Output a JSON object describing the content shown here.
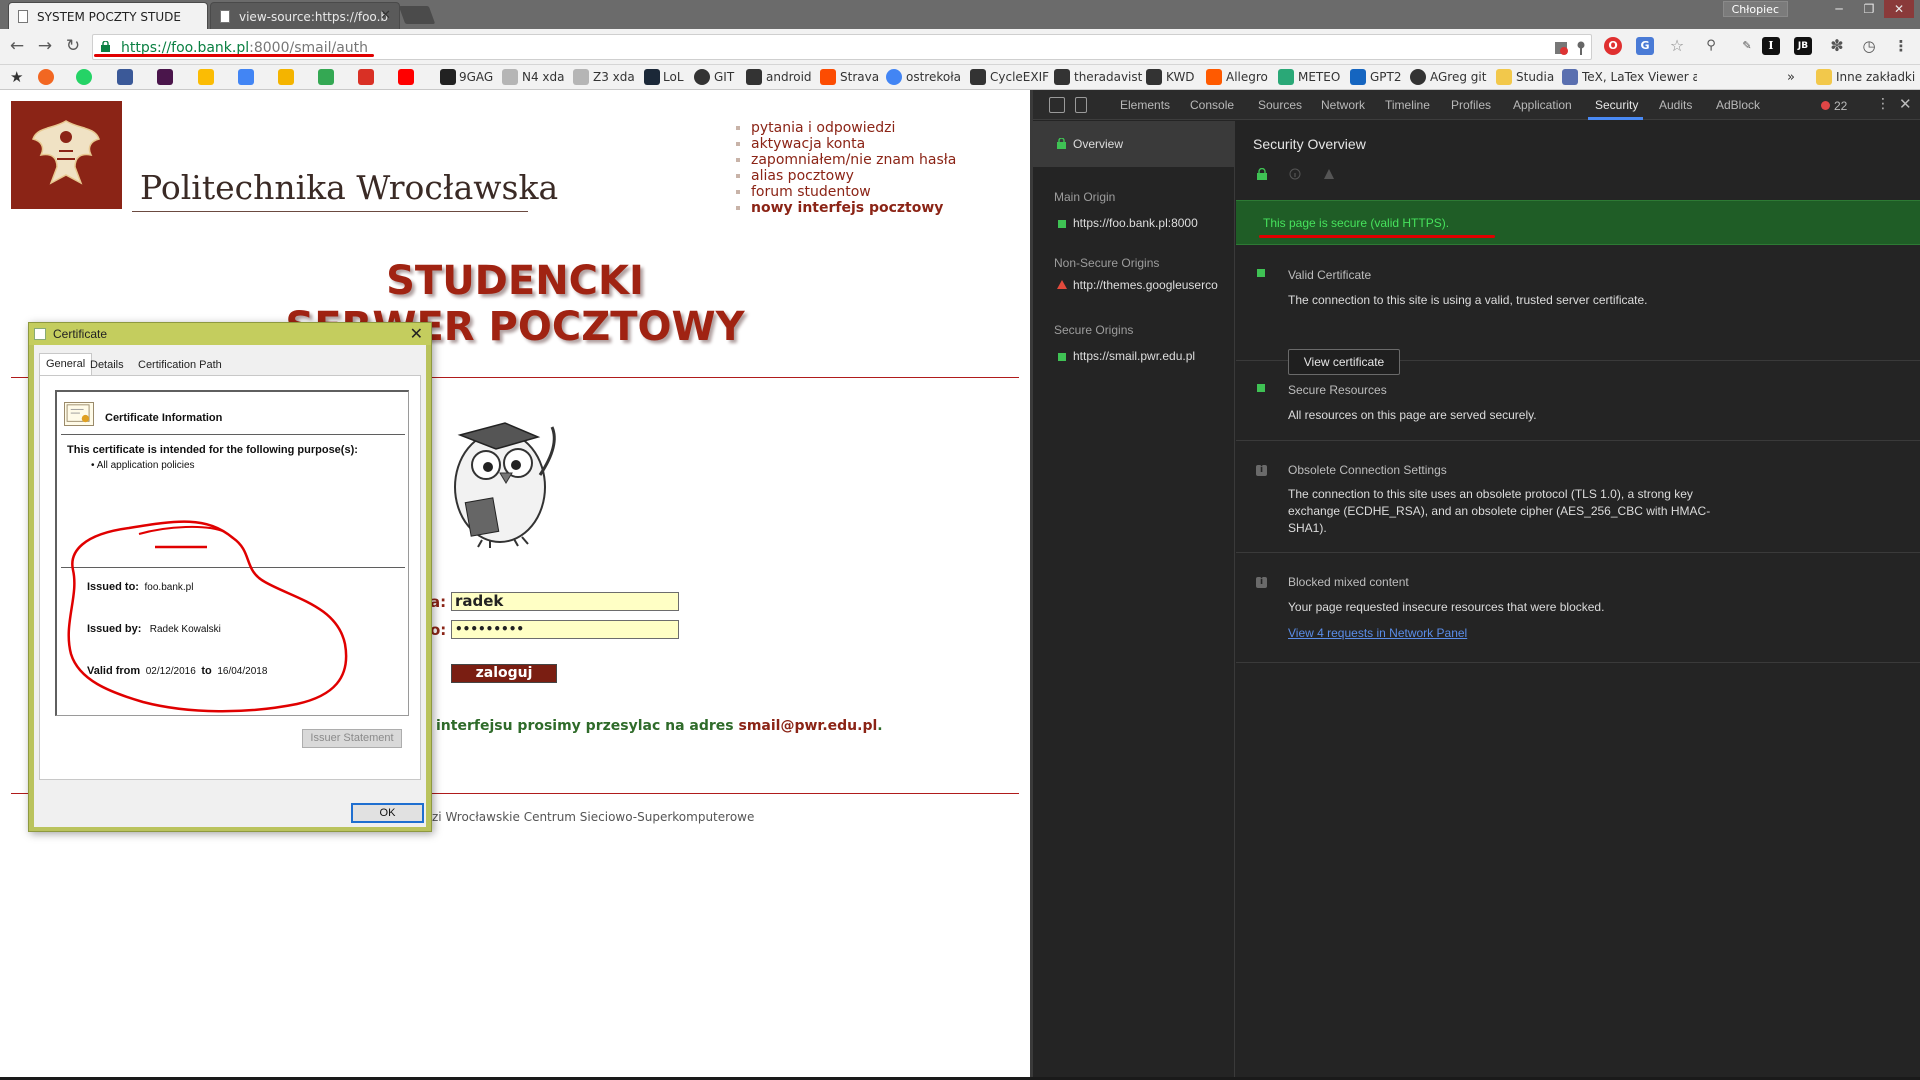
{
  "tabs": [
    {
      "title": "SYSTEM POCZTY STUDE",
      "active": true
    },
    {
      "title": "view-source:https://foo.b",
      "active": false
    }
  ],
  "window": {
    "user": "Chłopiec",
    "minimize": "─",
    "restore": "❐",
    "close": "✕"
  },
  "omnibox": {
    "url_host": "https://foo.bank.pl",
    "url_rest": ":8000/smail/auth"
  },
  "bookmarks": [
    {
      "label": "9GAG",
      "color": "#222222"
    },
    {
      "label": "N4 xda",
      "color": "#b5b5b5"
    },
    {
      "label": "Z3 xda",
      "color": "#b5b5b5"
    },
    {
      "label": "LoL",
      "color": "#1b2838"
    },
    {
      "label": "GIT",
      "color": "#333333"
    },
    {
      "label": "android",
      "color": "#333333"
    },
    {
      "label": "Strava",
      "color": "#fc4c02"
    },
    {
      "label": "ostrekoła",
      "color": "#4285f4"
    },
    {
      "label": "CycleEXIF",
      "color": "#333333"
    },
    {
      "label": "theradavist",
      "color": "#333333"
    },
    {
      "label": "KWD",
      "color": "#333333"
    },
    {
      "label": "Allegro",
      "color": "#ff5a00"
    },
    {
      "label": "METEO",
      "color": "#2aa877"
    },
    {
      "label": "GPT2",
      "color": "#1565c0"
    },
    {
      "label": "AGreg git",
      "color": "#333333"
    },
    {
      "label": "Studia",
      "color": "#f2c84b"
    },
    {
      "label": "TeX, LaTex Viewer and",
      "color": "#5a6fb0"
    }
  ],
  "bookmarks_overflow": "»",
  "bookmarks_other": "Inne zakładki",
  "page": {
    "logo_title": "Politechnika Wrocławska",
    "menu": [
      "pytania i odpowiedzi",
      "aktywacja konta",
      "zapomniałem/nie znam hasła",
      "alias pocztowy",
      "forum studentow",
      "nowy interfejs pocztowy"
    ],
    "hero_line1": "STUDENCKI",
    "hero_line2": "SERWER POCZTOWY",
    "login_label_user": "a:",
    "login_label_pass": "o:",
    "login_user_value": "radek",
    "login_pass_value": "•••••••••",
    "login_button": "zaloguj",
    "notice_text": "interfejsu prosimy przesylac na adres ",
    "notice_mail": "smail@pwr.edu.pl",
    "notice_end": ".",
    "footer": "zi Wrocławskie Centrum Sieciowo-Superkomputerowe"
  },
  "certificate": {
    "title": "Certificate",
    "tabs": [
      "General",
      "Details",
      "Certification Path"
    ],
    "info_title": "Certificate Information",
    "purpose_heading": "This certificate is intended for the following purpose(s):",
    "purpose_item": "• All application policies",
    "issued_to_label": "Issued to:",
    "issued_to": "foo.bank.pl",
    "issued_by_label": "Issued by:",
    "issued_by": "Radek Kowalski",
    "valid_from_label": "Valid from",
    "valid_from": "02/12/2016",
    "valid_to_label": "to",
    "valid_to": "16/04/2018",
    "issuer_statement": "Issuer Statement",
    "ok": "OK"
  },
  "devtools": {
    "tabs": [
      "Elements",
      "Console",
      "Sources",
      "Network",
      "Timeline",
      "Profiles",
      "Application",
      "Security",
      "Audits",
      "AdBlock"
    ],
    "active_tab": "Security",
    "error_count": "22",
    "sidebar": {
      "overview": "Overview",
      "main_origin_heading": "Main Origin",
      "main_origin": "https://foo.bank.pl:8000",
      "nonsecure_heading": "Non-Secure Origins",
      "nonsecure_origin": "http://themes.googleuserco",
      "secure_heading": "Secure Origins",
      "secure_origin": "https://smail.pwr.edu.pl"
    },
    "security": {
      "title": "Security Overview",
      "banner": "This page is secure (valid HTTPS).",
      "sections": [
        {
          "heading": "Valid Certificate",
          "desc": "The connection to this site is using a valid, trusted server certificate."
        },
        {
          "heading": "Secure Resources",
          "desc": "All resources on this page are served securely."
        },
        {
          "heading": "Obsolete Connection Settings",
          "desc": "The connection to this site uses an obsolete protocol (TLS 1.0), a strong key exchange (ECDHE_RSA), and an obsolete cipher (AES_256_CBC with HMAC-SHA1)."
        },
        {
          "heading": "Blocked mixed content",
          "desc": "Your page requested insecure resources that were blocked."
        }
      ],
      "view_certificate": "View certificate",
      "view_requests": "View 4 requests in Network Panel"
    }
  }
}
